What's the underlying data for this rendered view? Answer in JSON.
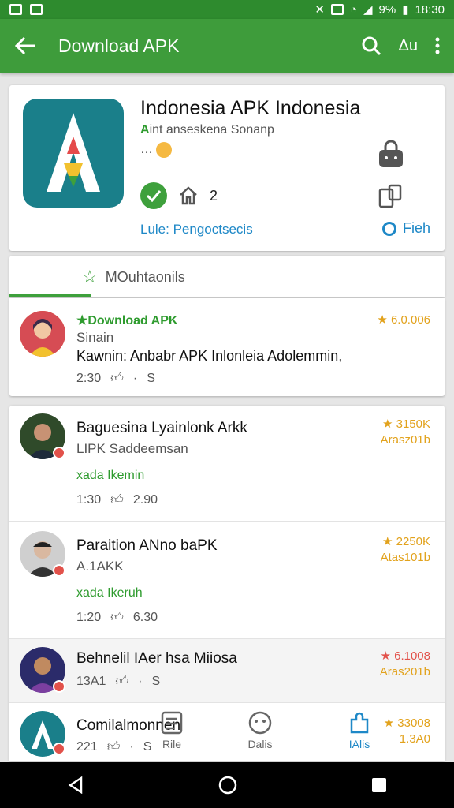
{
  "status_bar": {
    "battery": "9%",
    "time": "18:30"
  },
  "appbar": {
    "title": "Download APK",
    "action_label": "Δu"
  },
  "app": {
    "title": "Indonesia APK Indonesia",
    "subtitle_prefix": "A",
    "subtitle": "int anseskena Sonanp",
    "dots": "…",
    "count": "2",
    "link": "Lule: Pengoctsecis",
    "action": "Fieh"
  },
  "tab": {
    "label": "MOuhtaonils"
  },
  "items": [
    {
      "title": "Download APK",
      "sub": "Sinain",
      "desc": "Kawnin: Anbabr APK Inlonleia Adolemmin,",
      "meta_time": "2:30",
      "meta_value": "Ѕ",
      "rating": "6.0.006",
      "rating_sub": ""
    },
    {
      "title": "Baguesina Lyainlonk Arkk",
      "sub": "LIPK Saddeemsan",
      "green": "xada Ikemin",
      "meta_time": "1:30",
      "meta_value": "2.90",
      "rating": "3150K",
      "rating_sub": "Arasz01b"
    },
    {
      "title": "Paraition ANno baPK",
      "sub": "A.1AKK",
      "green": "xada Ikeruh",
      "meta_time": "1:20",
      "meta_value": "6.30",
      "rating": "2250K",
      "rating_sub": "Atas101b"
    },
    {
      "title": "Behnelil IAer hsa Miiosa",
      "sub": "",
      "meta_time": "13A1",
      "meta_value": "Ѕ",
      "rating": "6.1008",
      "rating_sub": "Aras201b"
    },
    {
      "title": "Comilalmonnen",
      "sub": "",
      "meta_time": "221",
      "meta_value": "Ѕ",
      "rating": "33008",
      "rating_sub": "1.3A0"
    }
  ],
  "bottom_nav": [
    {
      "label": "Rile"
    },
    {
      "label": "Dalis"
    },
    {
      "label": "IAlis"
    }
  ]
}
